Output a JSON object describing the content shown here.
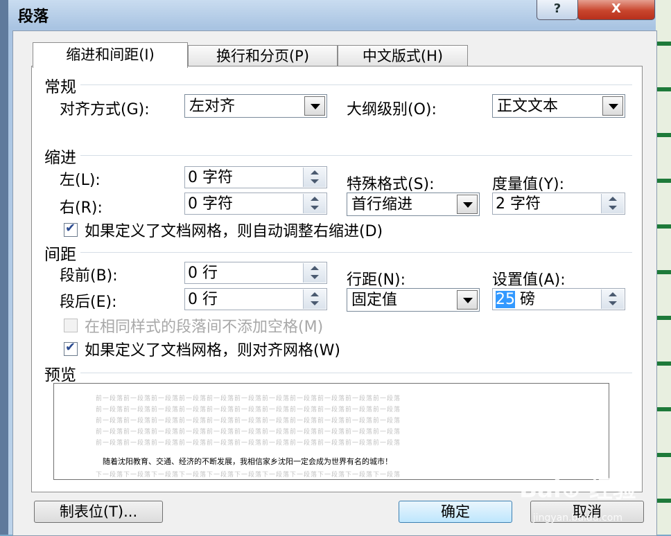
{
  "window": {
    "title": "段落",
    "help": "?",
    "close": "X"
  },
  "tabs": [
    "缩进和间距(I)",
    "换行和分页(P)",
    "中文版式(H)"
  ],
  "general": {
    "section": "常规",
    "align_label": "对齐方式(G):",
    "align_value": "左对齐",
    "outline_label": "大纲级别(O):",
    "outline_value": "正文文本"
  },
  "indent": {
    "section": "缩进",
    "left_label": "左(L):",
    "left_value": "0 字符",
    "right_label": "右(R):",
    "right_value": "0 字符",
    "special_label": "特殊格式(S):",
    "special_value": "首行缩进",
    "measure_label": "度量值(Y):",
    "measure_value": "2 字符",
    "auto_adjust": "如果定义了文档网格，则自动调整右缩进(D)"
  },
  "spacing": {
    "section": "间距",
    "before_label": "段前(B):",
    "before_value": "0 行",
    "after_label": "段后(E):",
    "after_value": "0 行",
    "line_label": "行距(N):",
    "line_value": "固定值",
    "setting_label": "设置值(A):",
    "setting_value_sel": "25",
    "setting_value_unit": " 磅",
    "no_space_same_style": "在相同样式的段落间不添加空格(M)",
    "snap_grid": "如果定义了文档网格，则对齐网格(W)"
  },
  "preview": {
    "section": "预览",
    "prev_line": "前一段落前一段落前一段落前一段落前一段落前一段落前一段落前一段落前一段落前一段落前一段落",
    "main_text": "随着沈阳教育、交通、经济的不断发展，我相信家乡沈阳一定会成为世界有名的城市！",
    "next_line": "下一段落下一段落下一段落下一段落下一段落下一段落下一段落下一段落下一段落下一段落下一段落"
  },
  "buttons": {
    "tabs": "制表位(T)...",
    "ok": "确定",
    "cancel": "取消"
  },
  "watermark": {
    "main": "Bai⊕ 经验",
    "sub": "jingyan.baidu.com"
  }
}
